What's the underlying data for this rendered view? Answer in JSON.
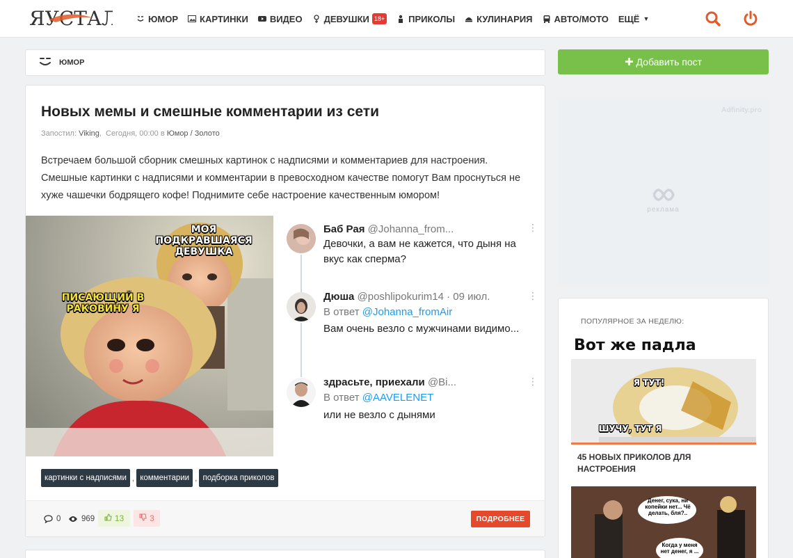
{
  "header": {
    "logo_text": "ЯУСТАЛ",
    "nav": [
      {
        "label": "ЮМОР",
        "icon": "smile-icon"
      },
      {
        "label": "КАРТИНКИ",
        "icon": "image-icon"
      },
      {
        "label": "ВИДЕО",
        "icon": "youtube-icon"
      },
      {
        "label": "ДЕВУШКИ",
        "icon": "female-icon",
        "badge": "18+"
      },
      {
        "label": "ПРИКОЛЫ",
        "icon": "person-icon"
      },
      {
        "label": "КУЛИНАРИЯ",
        "icon": "food-icon"
      },
      {
        "label": "АВТО/МОТО",
        "icon": "car-icon"
      },
      {
        "label": "ЕЩЁ",
        "icon": "chevron-down-icon"
      }
    ],
    "accent_color": "#e05a2a"
  },
  "breadcrumb": {
    "label": "ЮМОР",
    "icon": "smile-icon"
  },
  "post": {
    "title": "Новых мемы и смешные комментарии из сети",
    "meta": {
      "posted_label": "Запостил:",
      "author": "Viking",
      "date": "Сегодня, 00:00",
      "in_label": "в",
      "category": "Юмор",
      "sep": "/",
      "subcategory": "Золото"
    },
    "excerpt": "Встречаем большой сборник смешных картинок с надписями и комментариев для настроения. Смешные картинки с надписями и комментарии в превосходном качестве помогут Вам проснуться не хуже чашечки бодрящего кофе! Поднимите себе настроение качественным юмором!",
    "meme_captions": {
      "top": "МОЯ ПОДКРАВШАЯСЯ ДЕВУШКА",
      "left": "ПИСАЮЩИЙ В РАКОВИНУ Я"
    },
    "tweets": [
      {
        "name": "Баб Рая",
        "handle": "@Johanna_from...",
        "reply_label": "",
        "reply_to": "",
        "text": "Девочки, а вам не кажется, что дыня на вкус как сперма?"
      },
      {
        "name": "Дюша",
        "handle": "@poshlipokurim14 · 09 июл.",
        "reply_label": "В ответ",
        "reply_to": "@Johanna_fromAir",
        "text": "Вам очень везло с мужчинами видимо..."
      },
      {
        "name": "здрасьте, приехали",
        "handle": "@Bi...",
        "reply_label": "В ответ",
        "reply_to": "@AAVELENET",
        "text": "или не везло с дынями"
      }
    ],
    "tags": [
      "картинки с надписями",
      "комментарии",
      "подборка приколов"
    ],
    "tag_sep": ",",
    "stats": {
      "comments": "0",
      "views": "969",
      "likes": "13",
      "dislikes": "3"
    },
    "more_label": "ПОДРОБНЕЕ"
  },
  "sidebar": {
    "add_post_label": "Добавить пост",
    "ad_brand": "Adfinity.pro",
    "ad_label": "реклама",
    "popular_heading": "ПОПУЛЯРНОЕ ЗА НЕДЕЛЮ:",
    "popular_image_caption": "Вот же падла",
    "popular_image_bubble": "Я тут!",
    "popular_image_bottom": "Шучу, тут я",
    "popular_item_title": "45 новых приколов для настроения",
    "popular_image2_bubble1": "Денег, сука, ни копейки нет... Чё делать, бля?..",
    "popular_image2_bubble2": "Когда у меня нет денег, я ..."
  }
}
